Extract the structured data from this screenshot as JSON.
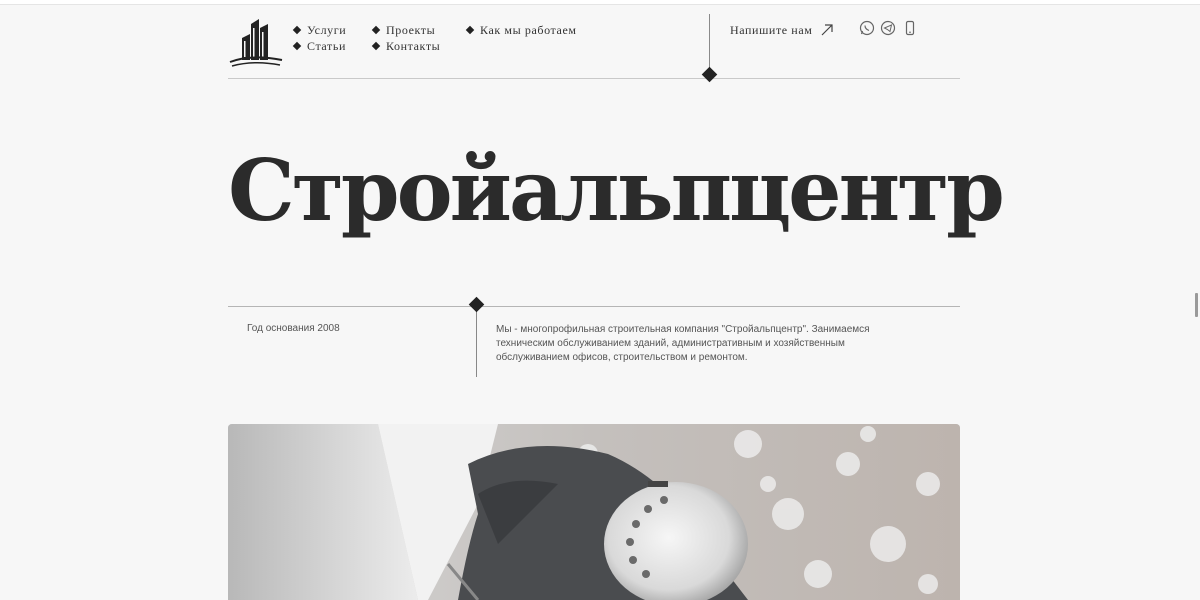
{
  "logo": {
    "icon": "buildings-logo-icon"
  },
  "nav": {
    "items": [
      {
        "label": "Услуги"
      },
      {
        "label": "Статьи"
      },
      {
        "label": "Проекты"
      },
      {
        "label": "Контакты"
      },
      {
        "label": "Как мы работаем"
      }
    ]
  },
  "contact": {
    "write_label": "Напишите нам",
    "write_icon": "arrow-up-right-icon",
    "social": [
      "whatsapp-icon",
      "telegram-icon",
      "phone-icon"
    ]
  },
  "hero": {
    "title": "Стройальпцентр"
  },
  "info": {
    "founded": "Год основания 2008",
    "about": "Мы - многопрофильная строительная компания \"Стройальпцентр\". Занимаемся техническим обслуживанием зданий, административным и хозяйственным обслуживанием офисов, строительством и ремонтом."
  },
  "photo": {
    "subject": "climber-with-helmet-photo"
  },
  "colors": {
    "background": "#f7f7f7",
    "text": "#2a2a2a",
    "accent": "#222222"
  }
}
